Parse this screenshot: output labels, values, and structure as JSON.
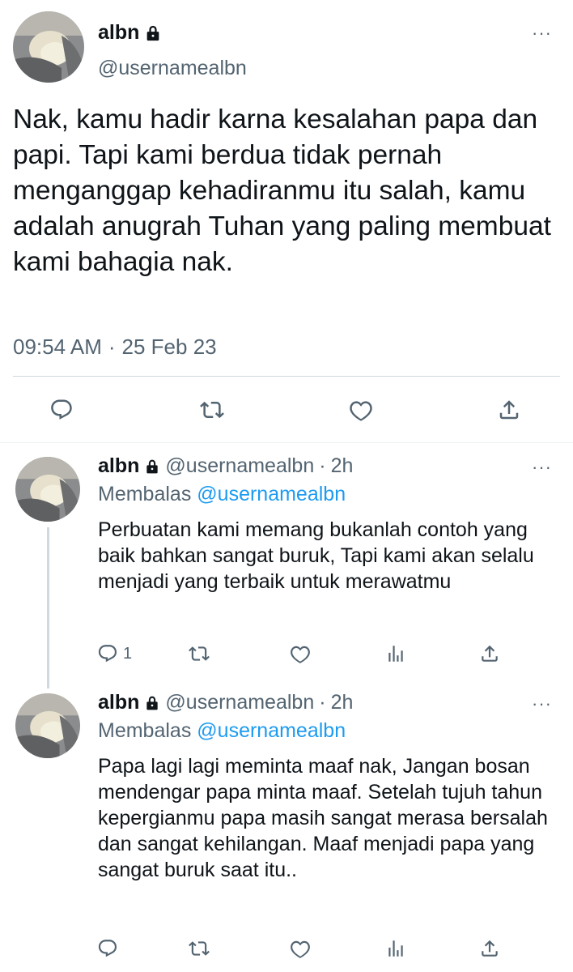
{
  "main_tweet": {
    "name": "albn",
    "handle": "@usernamealbn",
    "text": "Nak, kamu hadir karna kesalahan papa dan papi. Tapi kami berdua tidak pernah menganggap kehadiranmu itu salah, kamu adalah anugrah Tuhan yang paling membuat kami bahagia nak.",
    "time": "09:54 AM",
    "separator": "·",
    "date": "25 Feb 23",
    "more": "···",
    "actions": [
      "reply-icon",
      "retweet-icon",
      "like-icon",
      "share-icon"
    ]
  },
  "replies": [
    {
      "name": "albn",
      "handle": "@usernamealbn",
      "dot": "·",
      "time": "2h",
      "replying_prefix": "Membalas",
      "replying_to": "@usernamealbn",
      "text": "Perbuatan kami memang bukanlah contoh yang baik bahkan sangat buruk, Tapi kami akan selalu menjadi yang terbaik untuk merawatmu",
      "reply_count": "1",
      "more": "···"
    },
    {
      "name": "albn",
      "handle": "@usernamealbn",
      "dot": "·",
      "time": "2h",
      "replying_prefix": "Membalas",
      "replying_to": "@usernamealbn",
      "text": "Papa lagi lagi meminta maaf nak, Jangan bosan mendengar papa minta maaf. Setelah tujuh tahun kepergianmu papa masih sangat merasa bersalah dan sangat kehilangan. Maaf menjadi papa yang sangat buruk saat itu..",
      "reply_count": "",
      "more": "···"
    }
  ],
  "colors": {
    "text": "#0f1419",
    "secondary": "#536471",
    "link": "#1d9bf0",
    "divider": "#cfd9de"
  }
}
